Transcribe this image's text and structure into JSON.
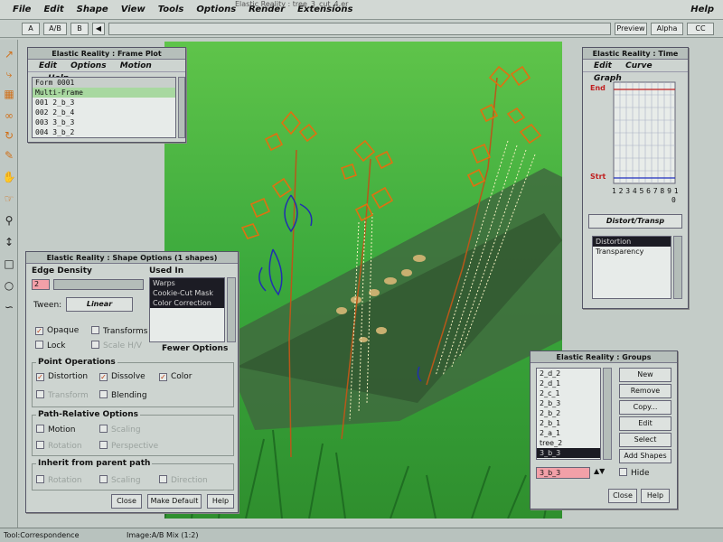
{
  "window": {
    "title": "Elastic Reality : tree_3_cut_4.er"
  },
  "menubar": {
    "items": [
      "File",
      "Edit",
      "Shape",
      "View",
      "Tools",
      "Options",
      "Render",
      "Extensions"
    ],
    "help": "Help"
  },
  "toolbar": {
    "a": "A",
    "ab": "A/B",
    "b": "B",
    "preview": "Preview",
    "alpha": "Alpha",
    "cc": "CC"
  },
  "frame_plot": {
    "title": "Elastic Reality : Frame Plot",
    "menu": [
      "Edit",
      "Options",
      "Motion",
      "Help"
    ],
    "header_left": "Form",
    "header_frame": "0001",
    "rows": [
      "Multi-Frame",
      "001 2_b_3",
      "002 2_b_4",
      "003 3_b_3",
      "004 3_b_2"
    ]
  },
  "time_window": {
    "title": "Elastic Reality : Time",
    "menu": [
      "Edit",
      "Curve",
      "Graph"
    ],
    "end_label": "End",
    "start_label": "Strt",
    "x_ticks": "1 2 3 4 5 6 7 8 9 1",
    "x_ticks2": "0",
    "dropdown": "Distort/Transp",
    "list": [
      "Distortion",
      "Transparency"
    ]
  },
  "shape_options": {
    "title": "Elastic Reality : Shape Options (1 shapes)",
    "edge_density_label": "Edge Density",
    "edge_density_value": "2",
    "used_in_label": "Used In",
    "used_in": [
      "Warps",
      "Cookie-Cut Mask",
      "Color Correction"
    ],
    "tween_label": "Tween:",
    "tween_value": "Linear",
    "opaque": "Opaque",
    "transforms": "Transforms",
    "lock": "Lock",
    "scale_hv": "Scale H/V",
    "fewer_options": "Fewer Options",
    "point_ops_label": "Point Operations",
    "distortion": "Distortion",
    "dissolve": "Dissolve",
    "color": "Color",
    "transform": "Transform",
    "blending": "Blending",
    "path_label": "Path-Relative Options",
    "motion": "Motion",
    "scaling": "Scaling",
    "rotation": "Rotation",
    "perspective": "Perspective",
    "inherit_label": "Inherit from parent path",
    "i_rotation": "Rotation",
    "i_scaling": "Scaling",
    "i_direction": "Direction",
    "close": "Close",
    "make_default": "Make Default",
    "help": "Help"
  },
  "groups": {
    "title": "Elastic Reality : Groups",
    "items": [
      "2_d_2",
      "2_d_1",
      "2_c_1",
      "2_b_3",
      "2_b_2",
      "2_b_1",
      "2_a_1",
      "tree_2",
      "3_b_3"
    ],
    "buttons": [
      "New",
      "Remove",
      "Copy...",
      "Edit",
      "Select",
      "Add Shapes"
    ],
    "name_value": "3_b_3",
    "hide": "Hide",
    "close": "Close",
    "help": "Help"
  },
  "status": {
    "tool": "Tool:Correspondence",
    "image": "Image:A/B Mix (1:2)"
  },
  "colors": {
    "accent_orange": "#e07010",
    "selection": "#1c1c24",
    "field_pink": "#f2a0a8",
    "grass": "#3cb040"
  }
}
